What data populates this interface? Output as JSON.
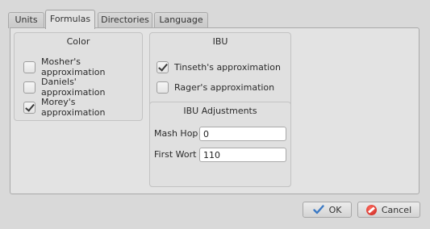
{
  "tabs": [
    {
      "label": "Units"
    },
    {
      "label": "Formulas",
      "active": true
    },
    {
      "label": "Directories"
    },
    {
      "label": "Language"
    }
  ],
  "color_group": {
    "title": "Color",
    "options": [
      {
        "label": "Mosher's approximation",
        "checked": false
      },
      {
        "label": "Daniels' approximation",
        "checked": false
      },
      {
        "label": "Morey's approximation",
        "checked": true
      }
    ]
  },
  "ibu_group": {
    "title": "IBU",
    "options": [
      {
        "label": "Tinseth's approximation",
        "checked": true
      },
      {
        "label": "Rager's approximation",
        "checked": false
      }
    ]
  },
  "ibu_adjustments": {
    "title": "IBU Adjustments",
    "mash_hop": {
      "label": "Mash Hop",
      "value": "0"
    },
    "first_wort": {
      "label": "First Wort",
      "value": "110"
    }
  },
  "buttons": {
    "ok": "OK",
    "cancel": "Cancel"
  },
  "icons": {
    "ok": "checkmark-icon",
    "cancel": "cancel-icon"
  }
}
